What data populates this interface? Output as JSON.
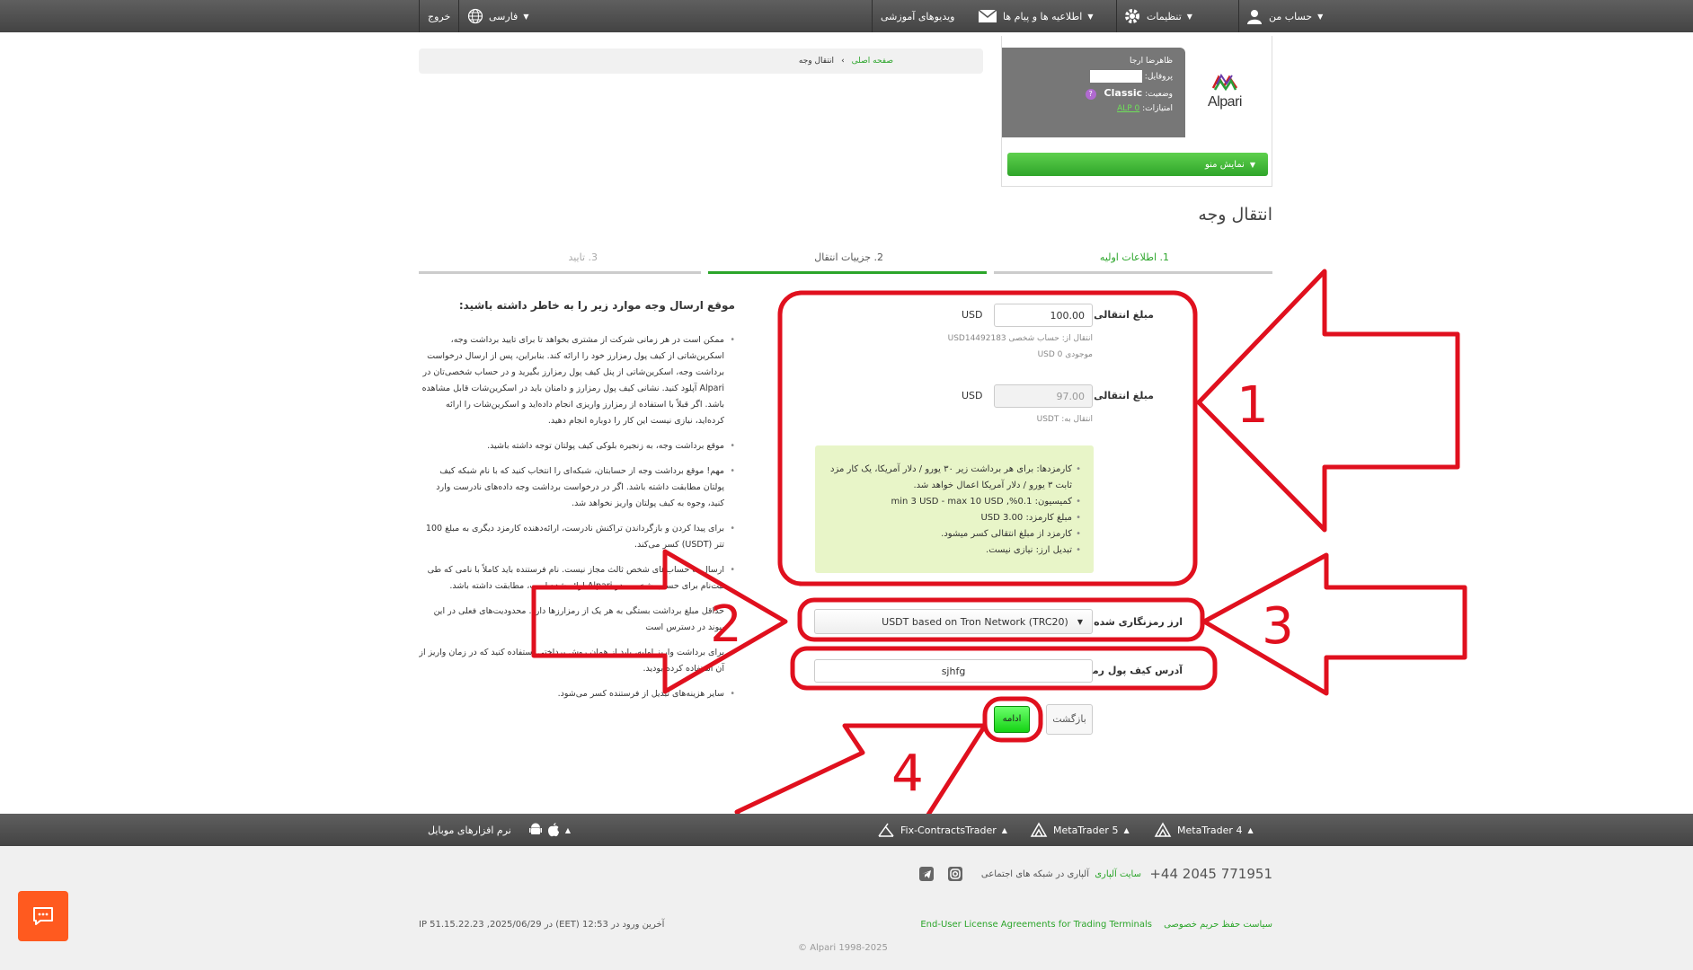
{
  "topbar": {
    "my_account": "حساب من",
    "settings": "تنظیمات",
    "messages": "اطلاعیه ها و پیام ها",
    "videos": "ویدیوهای آموزشی",
    "language": "فارسی",
    "logout": "خروج"
  },
  "profile": {
    "name": "ظاهرضا ارجا",
    "profile_label": "پروفایل:",
    "status_label": "وضعیت:",
    "status_value": "Classic",
    "points_label": "امتیازات:",
    "points_value": "ALP 0",
    "logo_text": "Alpari",
    "menu_button": "نمایش منو"
  },
  "breadcrumb": {
    "home": "صفحه اصلی",
    "current": "انتقال وجه"
  },
  "page_title": "انتقال وجه",
  "steps": [
    {
      "label": "1. اطلاعات اولیه"
    },
    {
      "label": "2. جزییات انتقال"
    },
    {
      "label": "3. تایید"
    }
  ],
  "form": {
    "amount_label": "مبلغ انتقالی:",
    "amount_value": "100.00",
    "amount_unit": "USD",
    "from_account": "انتقال از: حساب شخصی USD14492183",
    "balance": "موجودی USD 0",
    "amount2_label": "مبلغ انتقالی:",
    "amount2_value": "97.00",
    "amount2_unit": "USD",
    "to_currency": "انتقال به: USDT",
    "fee_items": [
      "کارمزدها: برای هر برداشت زیر ۳۰ یورو / دلار آمریکا، یک کار مزد ثابت ۳ یورو / دلار آمریکا اعمال خواهد شد.",
      "کمیسیون: 0.1%, min 3 USD - max 10 USD",
      "مبلغ کارمزد: 3.00 USD",
      "کارمزد از مبلغ انتقالی کسر میشود.",
      "تبدیل ارز: نیازی نیست."
    ],
    "crypto_label": "ارز رمزنگاری شده",
    "crypto_value": "USDT based on Tron Network (TRC20)",
    "wallet_label": "آدرس کیف پول رمزارز",
    "wallet_value": "sjhfg",
    "continue_button": "ادامه",
    "back_button": "بازگشت"
  },
  "info": {
    "heading": "موقع ارسال وجه موارد زیر را به خاطر داشته باشید:",
    "items": [
      "ممکن است در هر زمانی شرکت از مشتری بخواهد تا برای تایید برداشت وجه، اسکرین‌شاتی از کیف پول رمزارز خود را ارائه کند. بنابراین، پس از ارسال درخواست برداشت وجه، اسکرین‌شاتی از پنل کیف پول رمزارز بگیرید و در حساب شخصی‌تان در Alpari آپلود کنید. نشانی کیف پول رمزارز و دامنان باید در اسکرین‌شات قابل مشاهده باشد. اگر قبلاً با استفاده از رمزارز واریزی انجام داده‌اید و اسکرین‌شات را ارائه کرده‌اید، نیازی نیست این کار را دوباره انجام دهید.",
      "موقع برداشت وجه، به زنجیره بلوکی کیف پولتان توجه داشته باشید.",
      "مهم! موقع برداشت وجه از حسابتان، شبکه‌ای را انتخاب کنید که با نام شبکه کیف پولتان مطابقت داشته باشد. اگر در درخواست برداشت وجه داده‌های نادرست وارد کنید، وجوه به کیف پولتان واریز نخواهد شد.",
      "برای پیدا کردن و بازگرداندن تراکنش نادرست، ارائه‌دهنده کارمزد دیگری به مبلغ 100 تتر (USDT) کسر می‌کند.",
      "ارسال به حساب‌های شخص ثالث مجاز نیست. نام فرستنده باید کاملاً با نامی که طی ثبت‌نام برای حساب شخصی در Alpari ارائه شده است، مطابقت داشته باشد.",
      "حداقل مبلغ برداشت بستگی به هر یک از رمزارزها دارد. محدودیت‌های فعلی در این پیوند در دسترس است",
      "برای برداشت واریز اولیه، باید از همان روش پرداختی استفاده کنید که در زمان واریز از آن استفاده کرده بودید.",
      "سایر هزینه‌های تبدیل از فرستنده کسر می‌شود."
    ]
  },
  "annotations": [
    "1",
    "2",
    "3",
    "4"
  ],
  "footer_bar": {
    "mt4": "MetaTrader 4",
    "mt5": "MetaTrader 5",
    "fix": "Fix-ContractsTrader",
    "mobile": "نرم افزارهای موبایل"
  },
  "footer": {
    "phone": "+44 2045 771951",
    "site": "سایت آلپاری",
    "social": "آلپاری در شبکه های اجتماعی",
    "privacy": "سیاست حفظ حریم خصوصی",
    "eula": "End-User License Agreements for Trading Terminals",
    "last_login": "آخرین ورود در 12:53 (EET) در 2025/06/29, IP 51.15.22.23",
    "copyright": "Alpari 1998-2025 ©"
  },
  "colors": {
    "accent_green": "#2ba52a",
    "annotation_red": "#e0101e",
    "topbar": "#4f4f4f",
    "fee_box": "#e8f5c8",
    "chat": "#ff5a1f"
  }
}
